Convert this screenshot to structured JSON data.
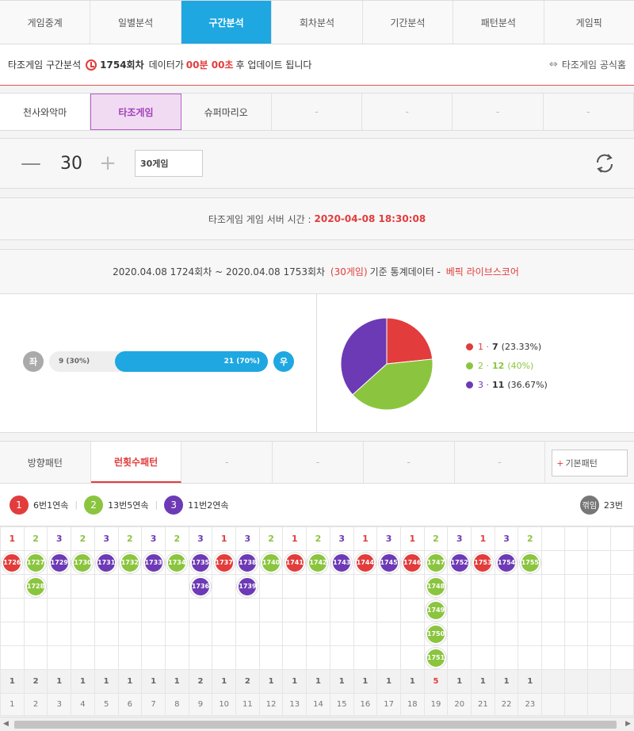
{
  "colors": {
    "accent": "#1ea7e1",
    "red": "#e23c3c",
    "green": "#8bc53f",
    "purple": "#6d3ab5",
    "grey": "#aaa"
  },
  "topnav": [
    "게임중계",
    "일별분석",
    "구간분석",
    "회차분석",
    "기간분석",
    "패턴분석",
    "게임픽"
  ],
  "topnav_active": 2,
  "info": {
    "prefix": "타조게임 구간분석",
    "round": "1754회차",
    "mid": "데이터가",
    "time": "00분 00초",
    "suffix": "후 업데이트 됩니다",
    "link": "타조게임 공식홈"
  },
  "gametabs": [
    "천사와악마",
    "타조게임",
    "슈퍼마리오",
    "-",
    "-",
    "-",
    "-"
  ],
  "gametabs_active": 1,
  "counter": {
    "minus": "—",
    "value": "30",
    "plus": "+",
    "select": "30게임"
  },
  "server": {
    "label": "타조게임 게임 서버 시간 :",
    "time": "2020-04-08 18:30:08"
  },
  "stats": {
    "range": "2020.04.08 1724회차 ~ 2020.04.08 1753회차",
    "games": "(30게임)",
    "text": "기준 통계데이터 -",
    "brand": "베픽 라이브스코어"
  },
  "leftright": {
    "left_label": "좌",
    "right_label": "우",
    "left_text": "9 (30%)",
    "right_text": "21 (70%)",
    "left_pct": 30,
    "right_pct": 70
  },
  "chart_data": {
    "type": "pie",
    "categories": [
      "1",
      "2",
      "3"
    ],
    "values": [
      7,
      12,
      11
    ],
    "labels": [
      "(23.33%)",
      "(40%)",
      "(36.67%)"
    ],
    "colors": [
      "#e23c3c",
      "#8bc53f",
      "#6d3ab5"
    ]
  },
  "pattabs": [
    "방향패턴",
    "런횟수패턴",
    "-",
    "-",
    "-",
    "-"
  ],
  "pattabs_active": 1,
  "basic_button": {
    "plus": "+",
    "label": "기본패턴"
  },
  "summary": {
    "items": [
      {
        "num": "1",
        "text": "6번1연속",
        "color": "#e23c3c"
      },
      {
        "num": "2",
        "text": "13번5연속",
        "color": "#8bc53f"
      },
      {
        "num": "3",
        "text": "11번2연속",
        "color": "#6d3ab5"
      }
    ],
    "right_icon": "꺾임",
    "right_text": "23번"
  },
  "columns": [
    {
      "h": "1",
      "balls": [
        "1726"
      ]
    },
    {
      "h": "2",
      "balls": [
        "1727",
        "1728"
      ]
    },
    {
      "h": "3",
      "balls": [
        "1729"
      ]
    },
    {
      "h": "2",
      "balls": [
        "1730"
      ]
    },
    {
      "h": "3",
      "balls": [
        "1731"
      ]
    },
    {
      "h": "2",
      "balls": [
        "1732"
      ]
    },
    {
      "h": "3",
      "balls": [
        "1733"
      ]
    },
    {
      "h": "2",
      "balls": [
        "1734"
      ]
    },
    {
      "h": "3",
      "balls": [
        "1735",
        "1736"
      ]
    },
    {
      "h": "1",
      "balls": [
        "1737"
      ]
    },
    {
      "h": "3",
      "balls": [
        "1738",
        "1739"
      ]
    },
    {
      "h": "2",
      "balls": [
        "1740"
      ]
    },
    {
      "h": "1",
      "balls": [
        "1741"
      ]
    },
    {
      "h": "2",
      "balls": [
        "1742"
      ]
    },
    {
      "h": "3",
      "balls": [
        "1743"
      ]
    },
    {
      "h": "1",
      "balls": [
        "1744"
      ]
    },
    {
      "h": "3",
      "balls": [
        "1745"
      ]
    },
    {
      "h": "1",
      "balls": [
        "1746"
      ]
    },
    {
      "h": "2",
      "balls": [
        "1747",
        "1748",
        "1749",
        "1750",
        "1751"
      ]
    },
    {
      "h": "3",
      "balls": [
        "1752"
      ]
    },
    {
      "h": "1",
      "balls": [
        "1753"
      ]
    },
    {
      "h": "3",
      "balls": [
        "1754"
      ]
    },
    {
      "h": "2",
      "balls": [
        "1755"
      ]
    },
    {
      "h": "",
      "balls": []
    },
    {
      "h": "",
      "balls": []
    },
    {
      "h": "",
      "balls": []
    },
    {
      "h": "",
      "balls": []
    }
  ],
  "counts": [
    "1",
    "2",
    "1",
    "1",
    "1",
    "1",
    "1",
    "1",
    "2",
    "1",
    "2",
    "1",
    "1",
    "1",
    "1",
    "1",
    "1",
    "1",
    "5",
    "1",
    "1",
    "1",
    "1",
    "",
    "",
    "",
    ""
  ],
  "indices": [
    "1",
    "2",
    "3",
    "4",
    "5",
    "6",
    "7",
    "8",
    "9",
    "10",
    "11",
    "12",
    "13",
    "14",
    "15",
    "16",
    "17",
    "18",
    "19",
    "20",
    "21",
    "22",
    "23",
    "",
    "",
    "",
    ""
  ]
}
